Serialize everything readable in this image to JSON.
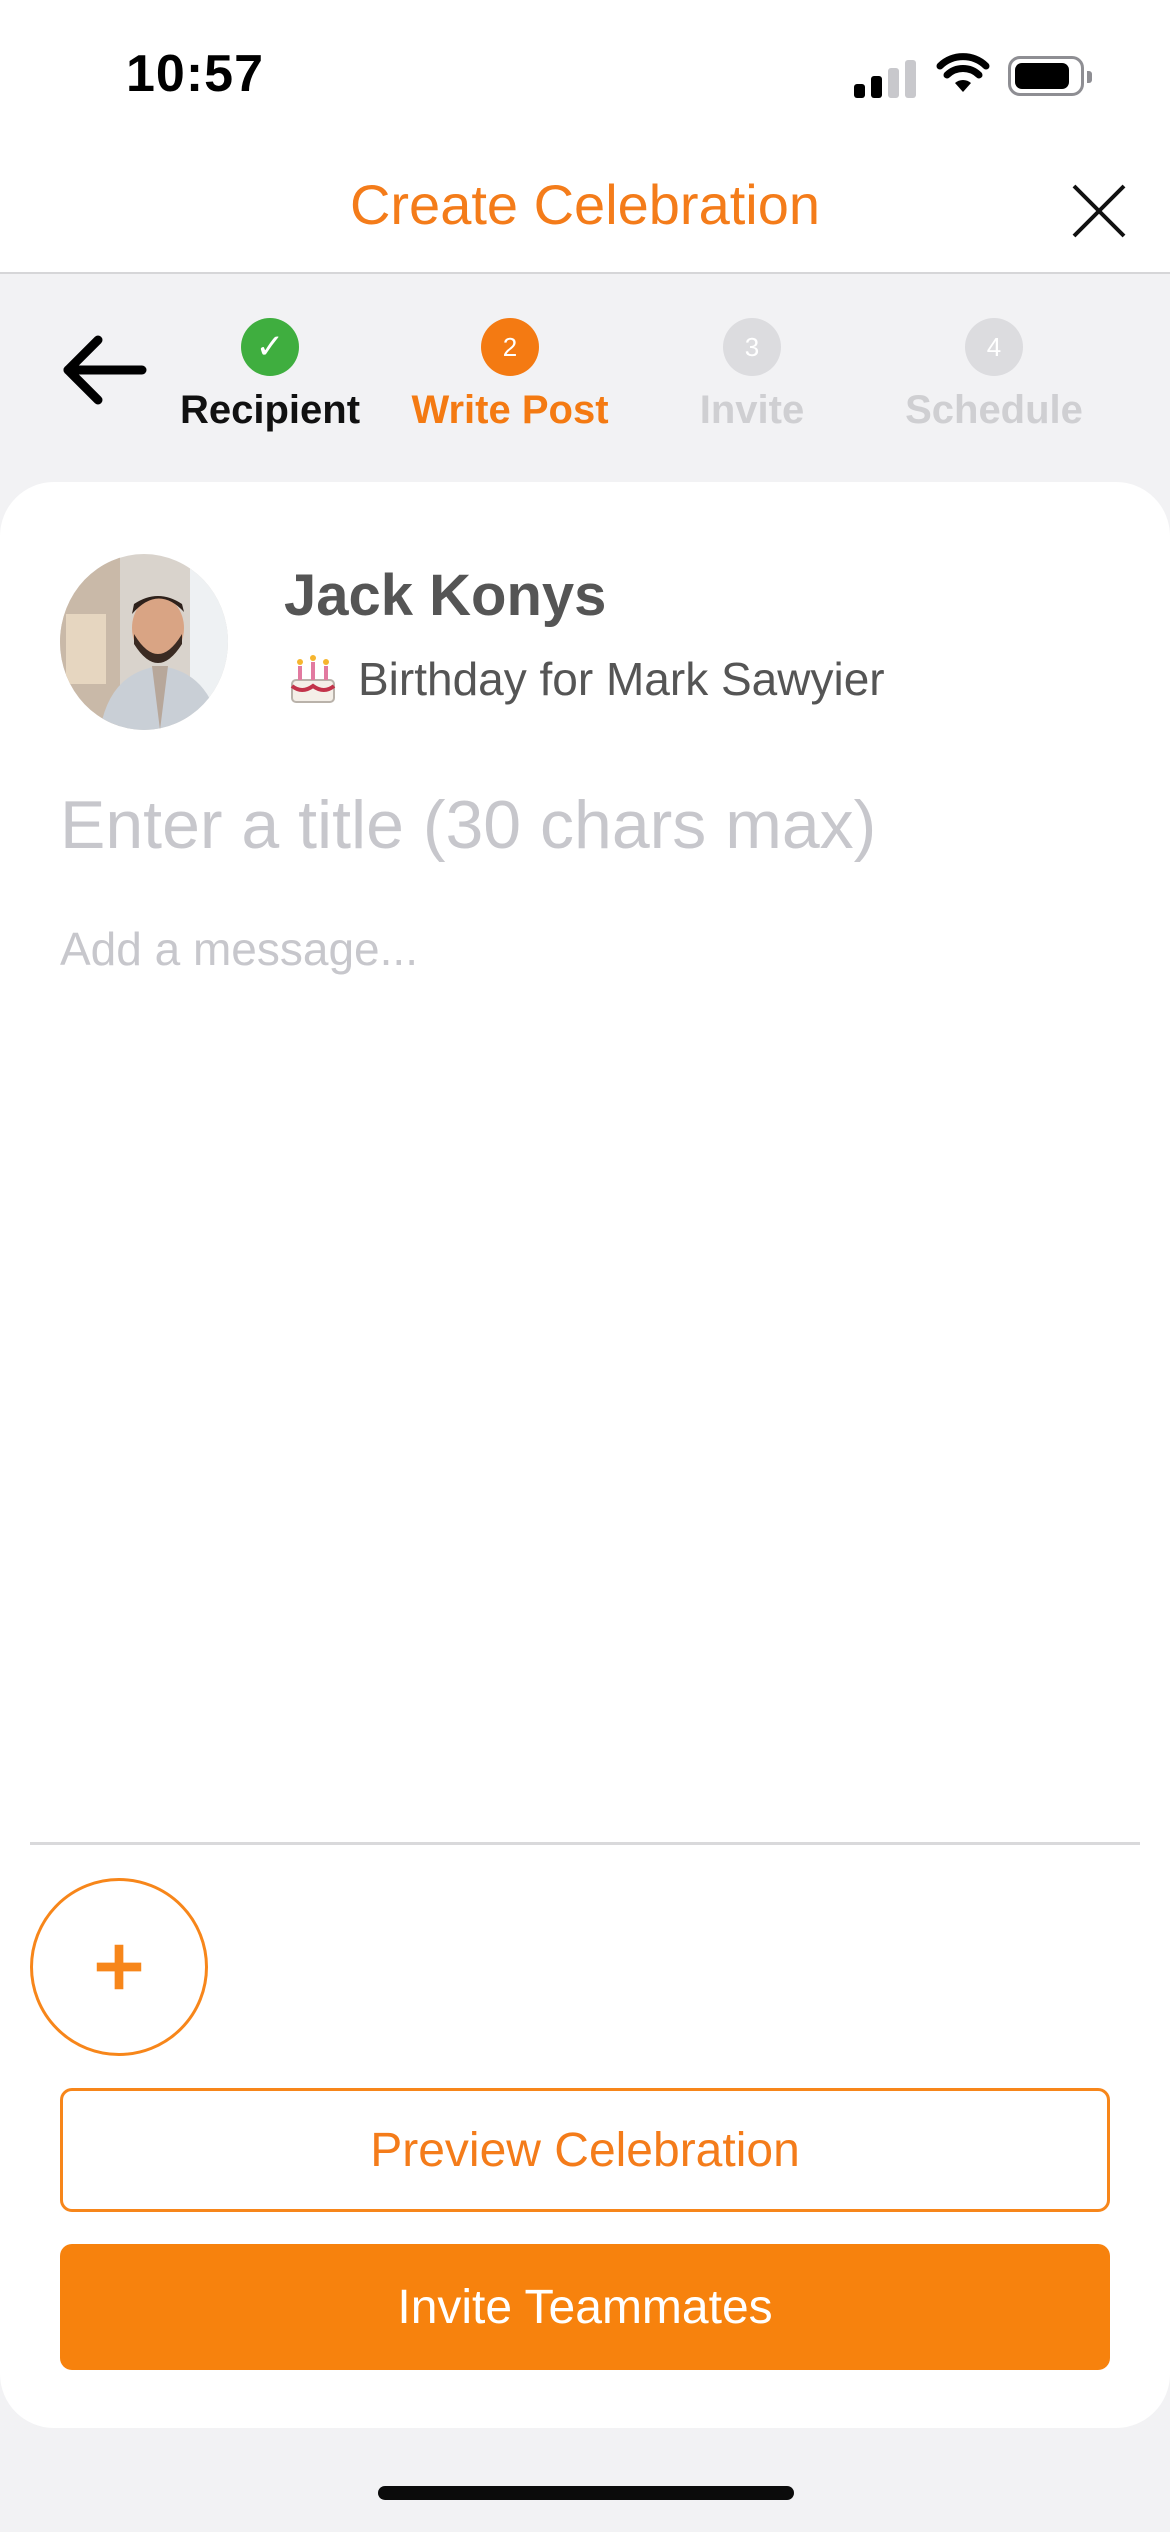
{
  "status_bar": {
    "time": "10:57"
  },
  "header": {
    "title": "Create Celebration",
    "close_icon": "close-icon"
  },
  "stepper": {
    "back_icon": "arrow-left-icon",
    "steps": [
      {
        "number": "✓",
        "label": "Recipient",
        "state": "done"
      },
      {
        "number": "2",
        "label": "Write Post",
        "state": "active"
      },
      {
        "number": "3",
        "label": "Invite",
        "state": "todo"
      },
      {
        "number": "4",
        "label": "Schedule",
        "state": "todo"
      }
    ]
  },
  "post": {
    "author": "Jack Konys",
    "occasion_icon": "birthday-cake-icon",
    "occasion": "Birthday for Mark Sawyier",
    "title_placeholder": "Enter a title (30 chars max)",
    "message_placeholder": "Add a message..."
  },
  "actions": {
    "add_icon": "plus-icon",
    "preview_label": "Preview Celebration",
    "invite_label": "Invite Teammates"
  },
  "colors": {
    "accent": "#f47c1a",
    "button_fill": "#f7820d",
    "step_done": "#3fae3f",
    "step_todo": "#dcdcdf",
    "background": "#f2f2f4"
  }
}
